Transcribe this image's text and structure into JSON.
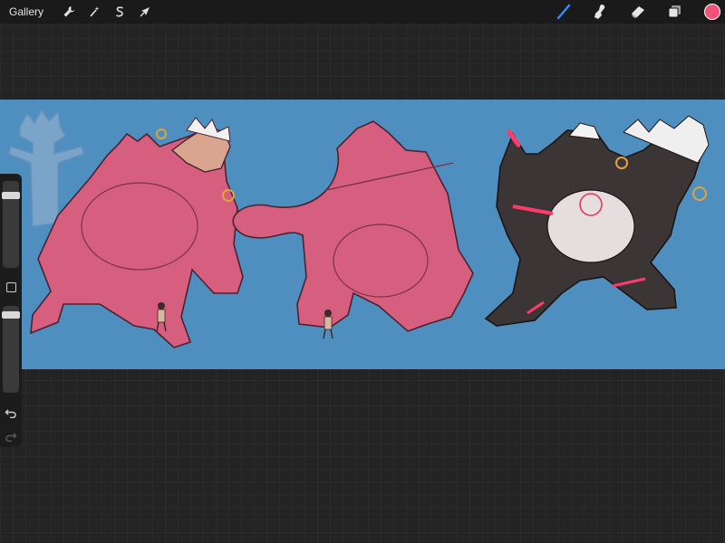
{
  "topbar": {
    "gallery_label": "Gallery",
    "left_tools": [
      {
        "name": "actions",
        "icon": "wrench-icon"
      },
      {
        "name": "adjustments",
        "icon": "magic-wand-icon"
      },
      {
        "name": "selection",
        "icon": "selection-s-icon"
      },
      {
        "name": "transform",
        "icon": "arrow-cursor-icon"
      }
    ],
    "right_tools": [
      {
        "name": "brush",
        "icon": "brush-icon",
        "active": true
      },
      {
        "name": "smudge",
        "icon": "smudge-finger-icon"
      },
      {
        "name": "eraser",
        "icon": "eraser-icon"
      },
      {
        "name": "layers",
        "icon": "layers-icon"
      },
      {
        "name": "color",
        "icon": "color-swatch-icon"
      }
    ],
    "active_color": "#f0527a",
    "active_tool_color": "#2f8fff"
  },
  "canvas": {
    "background_color": "#4f8fbf",
    "figure_sketch_color": "#d65f7f",
    "figure_finished_color": "#3b3536",
    "accent_color": "#ff3b6b"
  },
  "sidebar": {
    "brush_size_level": 0.12,
    "opacity_level": 0.06,
    "icons": [
      "modify-square-icon",
      "undo-icon",
      "redo-icon"
    ]
  }
}
